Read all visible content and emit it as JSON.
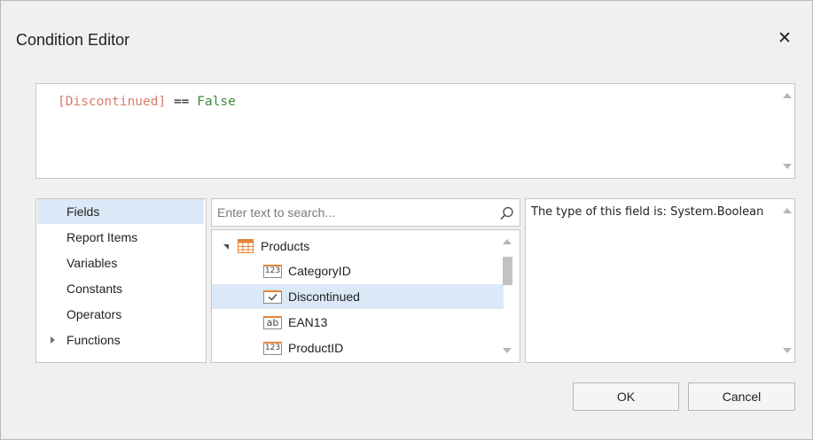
{
  "dialog": {
    "title": "Condition Editor",
    "close_glyph": "✕"
  },
  "expression": {
    "field": "[Discontinued]",
    "operator": "==",
    "value": "False",
    "colors": {
      "field": "#d87c6a",
      "value": "#3c8a3c"
    }
  },
  "categories": [
    {
      "label": "Fields",
      "selected": true,
      "expandable": false
    },
    {
      "label": "Report Items",
      "selected": false,
      "expandable": false
    },
    {
      "label": "Variables",
      "selected": false,
      "expandable": false
    },
    {
      "label": "Constants",
      "selected": false,
      "expandable": false
    },
    {
      "label": "Operators",
      "selected": false,
      "expandable": false
    },
    {
      "label": "Functions",
      "selected": false,
      "expandable": true
    }
  ],
  "search": {
    "placeholder": "Enter text to search...",
    "value": ""
  },
  "tree": {
    "root": {
      "label": "Products",
      "icon": "table-icon",
      "expanded": true
    },
    "children": [
      {
        "label": "CategoryID",
        "icon": "123",
        "selected": false
      },
      {
        "label": "Discontinued",
        "icon": "check",
        "selected": true
      },
      {
        "label": "EAN13",
        "icon": "ab",
        "selected": false
      },
      {
        "label": "ProductID",
        "icon": "123",
        "selected": false
      }
    ]
  },
  "description": {
    "text": "The type of this field is: System.Boolean"
  },
  "buttons": {
    "ok": "OK",
    "cancel": "Cancel"
  },
  "colors": {
    "selection": "#dbe8f7",
    "icon_accent": "#e7833a"
  }
}
